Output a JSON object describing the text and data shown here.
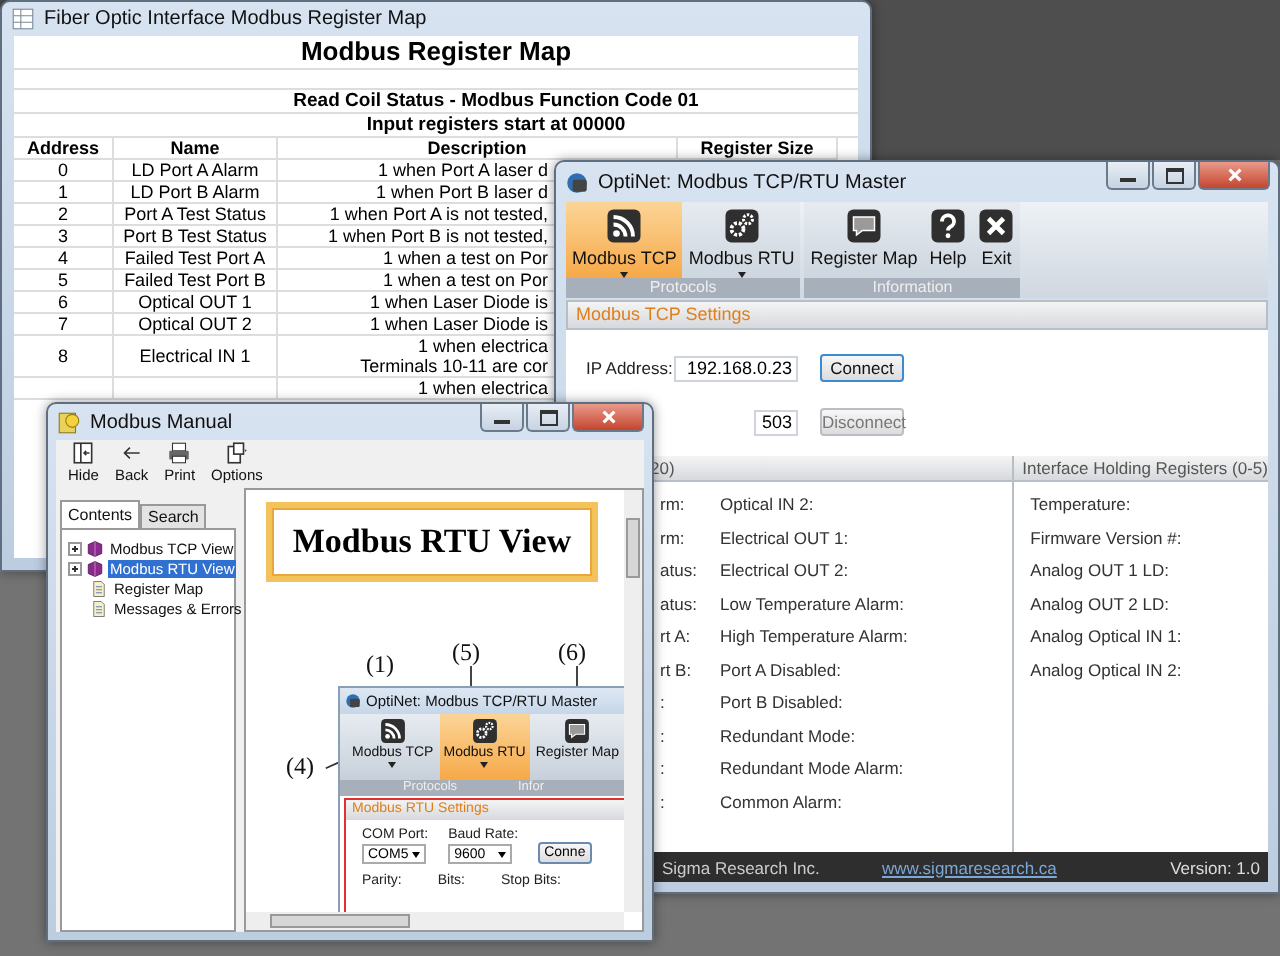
{
  "register_map_window": {
    "title": "Fiber Optic Interface Modbus Register Map",
    "heading": "Modbus Register Map",
    "section_title": "Read Coil Status - Modbus Function Code 01",
    "section_note": "Input registers start at 00000",
    "columns": [
      "Address",
      "Name",
      "Description",
      "Register Size"
    ],
    "rows": [
      {
        "address": "0",
        "name": "LD Port A Alarm",
        "description": [
          "1 when Port A laser d"
        ]
      },
      {
        "address": "1",
        "name": "LD Port B Alarm",
        "description": [
          "1 when Port B laser d"
        ]
      },
      {
        "address": "2",
        "name": "Port A Test Status",
        "description": [
          "1 when Port A is not tested,"
        ]
      },
      {
        "address": "3",
        "name": "Port B Test Status",
        "description": [
          "1 when Port B is not tested,"
        ]
      },
      {
        "address": "4",
        "name": "Failed Test Port A",
        "description": [
          "1 when a test on Por"
        ]
      },
      {
        "address": "5",
        "name": "Failed Test Port B",
        "description": [
          "1 when a test on Por"
        ]
      },
      {
        "address": "6",
        "name": "Optical OUT 1",
        "description": [
          "1 when Laser Diode is"
        ]
      },
      {
        "address": "7",
        "name": "Optical OUT 2",
        "description": [
          "1 when Laser Diode is"
        ]
      },
      {
        "address": "8",
        "name": "Electrical IN 1",
        "description": [
          "1 when electrica",
          "Terminals 10-11 are cor"
        ]
      },
      {
        "description": [
          "1 when electrica"
        ]
      }
    ]
  },
  "master_window": {
    "title": "OptiNet: Modbus TCP/RTU Master",
    "ribbon_groups": [
      {
        "label": "Protocols",
        "buttons": [
          {
            "label": "Modbus TCP",
            "selected": true,
            "dropdown": true
          },
          {
            "label": "Modbus RTU",
            "selected": false,
            "dropdown": true
          }
        ]
      },
      {
        "label": "Information",
        "buttons": [
          {
            "label": "Register Map",
            "selected": false,
            "dropdown": false
          },
          {
            "label": "Help",
            "selected": false,
            "dropdown": false
          },
          {
            "label": "Exit",
            "selected": false,
            "dropdown": false
          }
        ]
      }
    ],
    "settings": {
      "title": "Modbus TCP Settings",
      "ip_label": "IP Address:",
      "ip_value": "192.168.0.23",
      "connect": "Connect",
      "port_value": "503",
      "disconnect": "Disconnect",
      "disconnect_disabled": true
    },
    "left_panel": {
      "title": "20)",
      "column_1": [
        "rm:",
        "rm:",
        "atus:",
        "atus:",
        "rt A:",
        "rt B:",
        ":",
        ":",
        ":",
        ":"
      ],
      "column_2": [
        "Optical IN 2:",
        "Electrical OUT 1:",
        "Electrical OUT 2:",
        "Low Temperature Alarm:",
        "High Temperature Alarm:",
        "Port A Disabled:",
        "Port B Disabled:",
        "Redundant Mode:",
        "Redundant Mode Alarm:",
        "Common Alarm:"
      ]
    },
    "right_panel": {
      "title": "Interface Holding Registers (0-5)",
      "items": [
        "Temperature:",
        "Firmware Version #:",
        "Analog OUT 1 LD:",
        "Analog OUT 2 LD:",
        "Analog Optical IN 1:",
        "Analog Optical IN 2:"
      ]
    },
    "footer": {
      "copyright": "Sigma Research Inc.",
      "link": "www.sigmaresearch.ca",
      "version": "Version: 1.0"
    }
  },
  "manual_window": {
    "title": "Modbus Manual",
    "toolbar": [
      "Hide",
      "Back",
      "Print",
      "Options"
    ],
    "tabs": [
      {
        "label": "Contents",
        "selected": true
      },
      {
        "label": "Search",
        "selected": false
      }
    ],
    "tree": [
      {
        "label": "Modbus TCP View",
        "kind": "book",
        "expanded": false,
        "selected": false
      },
      {
        "label": "Modbus RTU View",
        "kind": "book",
        "expanded": false,
        "selected": true
      },
      {
        "label": "Register Map",
        "kind": "page",
        "selected": false
      },
      {
        "label": "Messages & Errors",
        "kind": "page",
        "selected": false
      }
    ],
    "document": {
      "heading": "Modbus RTU View",
      "callouts": [
        "(1)",
        "(5)",
        "(6)",
        "(4)"
      ],
      "screenshot": {
        "title": "OptiNet: Modbus TCP/RTU Master",
        "buttons": [
          {
            "label": "Modbus TCP",
            "selected": false
          },
          {
            "label": "Modbus RTU",
            "selected": true
          },
          {
            "label": "Register Map",
            "selected": false
          }
        ],
        "group_labels": [
          "Protocols",
          "Infor"
        ],
        "settings_title": "Modbus RTU Settings",
        "fields": [
          {
            "label": "COM Port:",
            "value": "COM5"
          },
          {
            "label": "Baud Rate:",
            "value": "9600"
          }
        ],
        "connect": "Conne",
        "bottom_labels": [
          "Parity:",
          "Bits:",
          "Stop Bits:"
        ]
      }
    }
  }
}
